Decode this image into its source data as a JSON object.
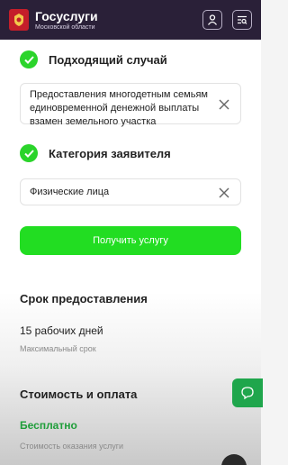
{
  "header": {
    "title": "Госуслуги",
    "subtitle": "Московской области",
    "icons": {
      "profile": "user-icon",
      "catalog": "catalog-search-icon"
    }
  },
  "form": {
    "case": {
      "label": "Подходящий случай",
      "value": "Предоставления многодетным семьям единовременной денежной выплаты взамен земельного участка"
    },
    "category": {
      "label": "Категория заявителя",
      "value": "Физические лица"
    },
    "submit_label": "Получить услугу"
  },
  "term": {
    "title": "Срок предоставления",
    "value": "15 рабочих дней",
    "note": "Максимальный срок"
  },
  "cost": {
    "title": "Стоимость и оплата",
    "value": "Бесплатно",
    "note": "Стоимость оказания услуги"
  },
  "colors": {
    "header_bg": "#2a2038",
    "accent_green": "#22dd22",
    "free_green": "#1f9e3a",
    "chat_green": "#1fa64c"
  }
}
